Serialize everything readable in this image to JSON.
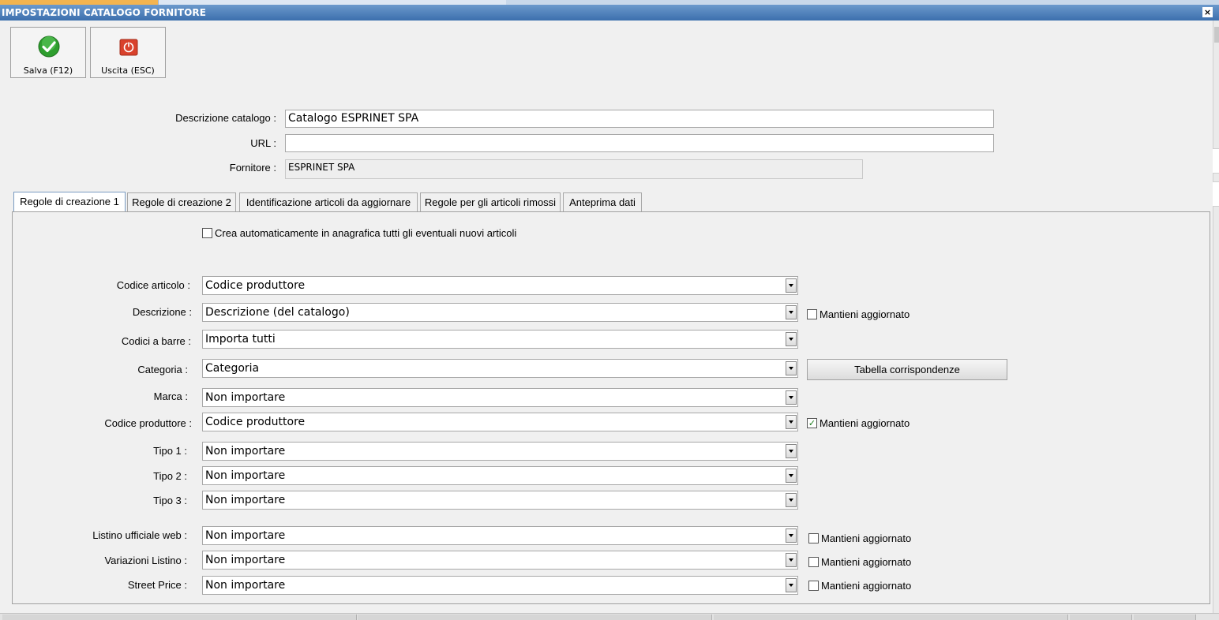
{
  "window": {
    "title": "IMPOSTAZIONI CATALOGO FORNITORE",
    "close_glyph": "×"
  },
  "toolbar": {
    "save_label": "Salva (F12)",
    "save_icon": "green-check-icon",
    "exit_label": "Uscita (ESC)",
    "exit_icon": "power-exit-icon"
  },
  "header_fields": {
    "descrizione_label": "Descrizione catalogo :",
    "descrizione_value": "Catalogo ESPRINET SPA",
    "url_label": "URL :",
    "url_value": "",
    "fornitore_label": "Fornitore :",
    "fornitore_value": "ESPRINET SPA"
  },
  "tabs": [
    {
      "label": "Regole di creazione 1",
      "active": true
    },
    {
      "label": "Regole di creazione 2",
      "active": false
    },
    {
      "label": "Identificazione articoli da aggiornare",
      "active": false
    },
    {
      "label": "Regole per gli articoli rimossi",
      "active": false
    },
    {
      "label": "Anteprima dati",
      "active": false
    }
  ],
  "auto_create": {
    "label": "Crea automaticamente in anagrafica tutti gli eventuali nuovi articoli",
    "checked": false
  },
  "rules": [
    {
      "label": "Codice articolo :",
      "value": "Codice produttore"
    },
    {
      "label": "Descrizione :",
      "value": "Descrizione (del catalogo)",
      "keep_label": "Mantieni aggiornato",
      "keep_checked": false
    },
    {
      "label": "Codici a barre :",
      "value": "Importa tutti"
    },
    {
      "label": "Categoria :",
      "value": "Categoria",
      "button_label": "Tabella corrispondenze"
    },
    {
      "label": "Marca :",
      "value": "Non importare"
    },
    {
      "label": "Codice produttore :",
      "value": "Codice produttore",
      "keep_label": "Mantieni aggiornato",
      "keep_checked": true
    },
    {
      "label": "Tipo 1 :",
      "value": "Non importare"
    },
    {
      "label": "Tipo 2 :",
      "value": "Non importare"
    },
    {
      "label": "Tipo 3 :",
      "value": "Non importare"
    },
    {
      "label": "Listino ufficiale web :",
      "value": "Non importare",
      "keep_label": "Mantieni aggiornato",
      "keep_checked": false
    },
    {
      "label": "Variazioni Listino :",
      "value": "Non importare",
      "keep_label": "Mantieni aggiornato",
      "keep_checked": false
    },
    {
      "label": "Street Price :",
      "value": "Non importare",
      "keep_label": "Mantieni aggiornato",
      "keep_checked": false
    }
  ],
  "check_glyph": "✓",
  "colors": {
    "titlebar": "#3c6fad",
    "save_icon": "#2e9e2e",
    "exit_icon": "#d9412b"
  }
}
